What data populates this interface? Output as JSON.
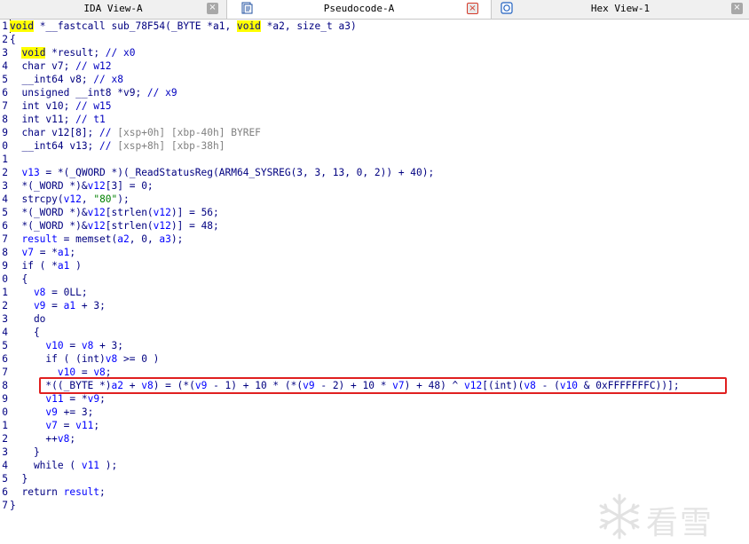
{
  "tabs": [
    {
      "label": "IDA View-A",
      "active": false,
      "close_style": "gray"
    },
    {
      "label": "Pseudocode-A",
      "active": true,
      "close_style": "red"
    },
    {
      "label": "Hex View-1",
      "active": false,
      "close_style": "gray"
    }
  ],
  "close_glyph": "×",
  "code_lines": [
    {
      "no": "1",
      "segs": [
        [
          "kwhl",
          "void"
        ],
        [
          "p",
          " *__fastcall sub_78F54(_BYTE *a1, "
        ],
        [
          "kwhl",
          "void"
        ],
        [
          "p",
          " *a2, size_t a3)"
        ]
      ]
    },
    {
      "no": "2",
      "segs": [
        [
          "p",
          "{"
        ]
      ]
    },
    {
      "no": "3",
      "segs": [
        [
          "p",
          "  "
        ],
        [
          "kwhl",
          "void"
        ],
        [
          "p",
          " *result; "
        ],
        [
          "cm",
          "// x0"
        ]
      ]
    },
    {
      "no": "4",
      "segs": [
        [
          "p",
          "  char v7; "
        ],
        [
          "cm",
          "// w12"
        ]
      ]
    },
    {
      "no": "5",
      "segs": [
        [
          "p",
          "  __int64 v8; "
        ],
        [
          "cm",
          "// x8"
        ]
      ]
    },
    {
      "no": "6",
      "segs": [
        [
          "p",
          "  unsigned __int8 *v9; "
        ],
        [
          "cm",
          "// x9"
        ]
      ]
    },
    {
      "no": "7",
      "segs": [
        [
          "p",
          "  int v10; "
        ],
        [
          "cm",
          "// w15"
        ]
      ]
    },
    {
      "no": "8",
      "segs": [
        [
          "p",
          "  int v11; "
        ],
        [
          "cm",
          "// t1"
        ]
      ]
    },
    {
      "no": "9",
      "segs": [
        [
          "p",
          "  char v12[8]; "
        ],
        [
          "cm",
          "// "
        ],
        [
          "cmg",
          "[xsp+0h] [xbp-40h] BYREF"
        ]
      ]
    },
    {
      "no": "0",
      "segs": [
        [
          "p",
          "  __int64 v13; "
        ],
        [
          "cm",
          "// "
        ],
        [
          "cmg",
          "[xsp+8h] [xbp-38h]"
        ]
      ]
    },
    {
      "no": "1",
      "segs": [
        [
          "p",
          ""
        ]
      ]
    },
    {
      "no": "2",
      "segs": [
        [
          "lvar",
          "  v13"
        ],
        [
          "p",
          " = *(_QWORD *)(_ReadStatusReg(ARM64_SYSREG(3, 3, 13, 0, 2)) + 40);"
        ]
      ]
    },
    {
      "no": "3",
      "segs": [
        [
          "p",
          "  *(_WORD *)&"
        ],
        [
          "lvar",
          "v12"
        ],
        [
          "p",
          "[3] = 0;"
        ]
      ]
    },
    {
      "no": "4",
      "segs": [
        [
          "p",
          "  strcpy("
        ],
        [
          "lvar",
          "v12"
        ],
        [
          "p",
          ", "
        ],
        [
          "str",
          "\"80\""
        ],
        [
          "p",
          ");"
        ]
      ]
    },
    {
      "no": "5",
      "segs": [
        [
          "p",
          "  *(_WORD *)&"
        ],
        [
          "lvar",
          "v12"
        ],
        [
          "p",
          "[strlen("
        ],
        [
          "lvar",
          "v12"
        ],
        [
          "p",
          ")] = 56;"
        ]
      ]
    },
    {
      "no": "6",
      "segs": [
        [
          "p",
          "  *(_WORD *)&"
        ],
        [
          "lvar",
          "v12"
        ],
        [
          "p",
          "[strlen("
        ],
        [
          "lvar",
          "v12"
        ],
        [
          "p",
          ")] = 48;"
        ]
      ]
    },
    {
      "no": "7",
      "segs": [
        [
          "lvar",
          "  result"
        ],
        [
          "p",
          " = memset("
        ],
        [
          "lvar",
          "a2"
        ],
        [
          "p",
          ", 0, "
        ],
        [
          "lvar",
          "a3"
        ],
        [
          "p",
          ");"
        ]
      ]
    },
    {
      "no": "8",
      "segs": [
        [
          "lvar",
          "  v7"
        ],
        [
          "p",
          " = *"
        ],
        [
          "lvar",
          "a1"
        ],
        [
          "p",
          ";"
        ]
      ]
    },
    {
      "no": "9",
      "segs": [
        [
          "p",
          "  if ( *"
        ],
        [
          "lvar",
          "a1"
        ],
        [
          "p",
          " )"
        ]
      ]
    },
    {
      "no": "0",
      "segs": [
        [
          "p",
          "  {"
        ]
      ]
    },
    {
      "no": "1",
      "segs": [
        [
          "lvar",
          "    v8"
        ],
        [
          "p",
          " = 0LL;"
        ]
      ]
    },
    {
      "no": "2",
      "segs": [
        [
          "lvar",
          "    v9"
        ],
        [
          "p",
          " = "
        ],
        [
          "lvar",
          "a1"
        ],
        [
          "p",
          " + 3;"
        ]
      ]
    },
    {
      "no": "3",
      "segs": [
        [
          "p",
          "    do"
        ]
      ]
    },
    {
      "no": "4",
      "segs": [
        [
          "p",
          "    {"
        ]
      ]
    },
    {
      "no": "5",
      "segs": [
        [
          "lvar",
          "      v10"
        ],
        [
          "p",
          " = "
        ],
        [
          "lvar",
          "v8"
        ],
        [
          "p",
          " + 3;"
        ]
      ]
    },
    {
      "no": "6",
      "segs": [
        [
          "p",
          "      if ( (int)"
        ],
        [
          "lvar",
          "v8"
        ],
        [
          "p",
          " >= 0 )"
        ]
      ]
    },
    {
      "no": "7",
      "segs": [
        [
          "lvar",
          "        v10"
        ],
        [
          "p",
          " = "
        ],
        [
          "lvar",
          "v8"
        ],
        [
          "p",
          ";"
        ]
      ]
    },
    {
      "no": "8",
      "segs": [
        [
          "p",
          "      *((_BYTE *)"
        ],
        [
          "lvar",
          "a2"
        ],
        [
          "p",
          " + "
        ],
        [
          "lvar",
          "v8"
        ],
        [
          "p",
          ") = (*("
        ],
        [
          "lvar",
          "v9"
        ],
        [
          "p",
          " - 1) + 10 * (*("
        ],
        [
          "lvar",
          "v9"
        ],
        [
          "p",
          " - 2) + 10 * "
        ],
        [
          "lvar",
          "v7"
        ],
        [
          "p",
          ") + 48) ^ "
        ],
        [
          "lvar",
          "v12"
        ],
        [
          "p",
          "[(int)("
        ],
        [
          "lvar",
          "v8"
        ],
        [
          "p",
          " - ("
        ],
        [
          "lvar",
          "v10"
        ],
        [
          "p",
          " & 0xFFFFFFFC))];"
        ]
      ]
    },
    {
      "no": "9",
      "segs": [
        [
          "lvar",
          "      v11"
        ],
        [
          "p",
          " = *"
        ],
        [
          "lvar",
          "v9"
        ],
        [
          "p",
          ";"
        ]
      ]
    },
    {
      "no": "0",
      "segs": [
        [
          "lvar",
          "      v9"
        ],
        [
          "p",
          " += 3;"
        ]
      ]
    },
    {
      "no": "1",
      "segs": [
        [
          "lvar",
          "      v7"
        ],
        [
          "p",
          " = "
        ],
        [
          "lvar",
          "v11"
        ],
        [
          "p",
          ";"
        ]
      ]
    },
    {
      "no": "2",
      "segs": [
        [
          "p",
          "      ++"
        ],
        [
          "lvar",
          "v8"
        ],
        [
          "p",
          ";"
        ]
      ]
    },
    {
      "no": "3",
      "segs": [
        [
          "p",
          "    }"
        ]
      ]
    },
    {
      "no": "4",
      "segs": [
        [
          "p",
          "    while ( "
        ],
        [
          "lvar",
          "v11"
        ],
        [
          "p",
          " );"
        ]
      ]
    },
    {
      "no": "5",
      "segs": [
        [
          "p",
          "  }"
        ]
      ]
    },
    {
      "no": "6",
      "segs": [
        [
          "p",
          "  return "
        ],
        [
          "lvar",
          "result"
        ],
        [
          "p",
          ";"
        ]
      ]
    },
    {
      "no": "7",
      "segs": [
        [
          "p",
          "}"
        ]
      ]
    }
  ],
  "watermark": {
    "text": "看雪",
    "icon": "snowflake-icon"
  },
  "colors": {
    "highlight_box": "#e02020",
    "keyword_highlight": "#ffff00"
  }
}
